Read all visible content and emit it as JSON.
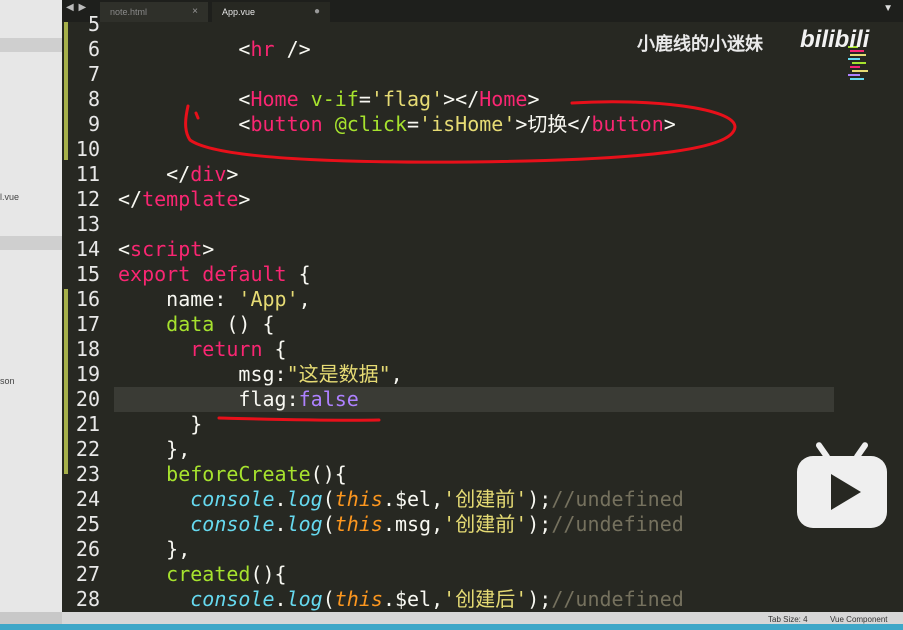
{
  "editor": {
    "tabs": [
      {
        "label": "note.html",
        "close": "×",
        "active": false
      },
      {
        "label": "App.vue",
        "close": "●",
        "active": true
      }
    ],
    "nav_arrows": "◀ ▶",
    "corner_button": "▼"
  },
  "sidebar": {
    "items": [
      {
        "label": "l.vue"
      },
      {
        "label": "son"
      }
    ]
  },
  "code": {
    "line_numbers": [
      "5",
      "6",
      "7",
      "8",
      "9",
      "10",
      "11",
      "12",
      "13",
      "14",
      "15",
      "16",
      "17",
      "18",
      "19",
      "20",
      "21",
      "22",
      "23",
      "24",
      "25",
      "26",
      "27",
      "28"
    ],
    "highlighted_line": "20",
    "lines": [
      [
        {
          "t": "p",
          "v": ""
        }
      ],
      [
        {
          "t": "p",
          "v": "          <"
        },
        {
          "t": "tag",
          "v": "hr"
        },
        {
          "t": "p",
          "v": " />"
        }
      ],
      [
        {
          "t": "p",
          "v": ""
        }
      ],
      [
        {
          "t": "p",
          "v": "          <"
        },
        {
          "t": "tag",
          "v": "Home"
        },
        {
          "t": "p",
          "v": " "
        },
        {
          "t": "attr",
          "v": "v-if"
        },
        {
          "t": "p",
          "v": "="
        },
        {
          "t": "str",
          "v": "'flag'"
        },
        {
          "t": "p",
          "v": "></"
        },
        {
          "t": "tag",
          "v": "Home"
        },
        {
          "t": "p",
          "v": ">"
        }
      ],
      [
        {
          "t": "p",
          "v": "          <"
        },
        {
          "t": "tag",
          "v": "button"
        },
        {
          "t": "p",
          "v": " "
        },
        {
          "t": "attr",
          "v": "@click"
        },
        {
          "t": "p",
          "v": "="
        },
        {
          "t": "str",
          "v": "'isHome'"
        },
        {
          "t": "p",
          "v": ">切换</"
        },
        {
          "t": "tag",
          "v": "button"
        },
        {
          "t": "p",
          "v": ">"
        }
      ],
      [
        {
          "t": "p",
          "v": ""
        }
      ],
      [
        {
          "t": "p",
          "v": "    </"
        },
        {
          "t": "tag",
          "v": "div"
        },
        {
          "t": "p",
          "v": ">"
        }
      ],
      [
        {
          "t": "p",
          "v": "</"
        },
        {
          "t": "tag",
          "v": "template"
        },
        {
          "t": "p",
          "v": ">"
        }
      ],
      [
        {
          "t": "p",
          "v": ""
        }
      ],
      [
        {
          "t": "p",
          "v": "<"
        },
        {
          "t": "tag",
          "v": "script"
        },
        {
          "t": "p",
          "v": ">"
        }
      ],
      [
        {
          "t": "kw",
          "v": "export"
        },
        {
          "t": "p",
          "v": " "
        },
        {
          "t": "kw",
          "v": "default"
        },
        {
          "t": "p",
          "v": " {"
        }
      ],
      [
        {
          "t": "p",
          "v": "    name: "
        },
        {
          "t": "str",
          "v": "'App'"
        },
        {
          "t": "p",
          "v": ","
        }
      ],
      [
        {
          "t": "p",
          "v": "    "
        },
        {
          "t": "fn",
          "v": "data"
        },
        {
          "t": "p",
          "v": " () {"
        }
      ],
      [
        {
          "t": "p",
          "v": "      "
        },
        {
          "t": "kw",
          "v": "return"
        },
        {
          "t": "p",
          "v": " {"
        }
      ],
      [
        {
          "t": "p",
          "v": "          msg:"
        },
        {
          "t": "str",
          "v": "\"这是数据\""
        },
        {
          "t": "p",
          "v": ","
        }
      ],
      [
        {
          "t": "p",
          "v": "          flag:"
        },
        {
          "t": "bool",
          "v": "false"
        }
      ],
      [
        {
          "t": "p",
          "v": "      }"
        }
      ],
      [
        {
          "t": "p",
          "v": "    },"
        }
      ],
      [
        {
          "t": "p",
          "v": "    "
        },
        {
          "t": "fn",
          "v": "beforeCreate"
        },
        {
          "t": "p",
          "v": "(){"
        }
      ],
      [
        {
          "t": "p",
          "v": "      "
        },
        {
          "t": "blue",
          "v": "console"
        },
        {
          "t": "p",
          "v": "."
        },
        {
          "t": "blue",
          "v": "log"
        },
        {
          "t": "p",
          "v": "("
        },
        {
          "t": "this",
          "v": "this"
        },
        {
          "t": "p",
          "v": ".$el,"
        },
        {
          "t": "str",
          "v": "'创建前'"
        },
        {
          "t": "p",
          "v": ");"
        },
        {
          "t": "cm",
          "v": "//undefined"
        }
      ],
      [
        {
          "t": "p",
          "v": "      "
        },
        {
          "t": "blue",
          "v": "console"
        },
        {
          "t": "p",
          "v": "."
        },
        {
          "t": "blue",
          "v": "log"
        },
        {
          "t": "p",
          "v": "("
        },
        {
          "t": "this",
          "v": "this"
        },
        {
          "t": "p",
          "v": ".msg,"
        },
        {
          "t": "str",
          "v": "'创建前'"
        },
        {
          "t": "p",
          "v": ");"
        },
        {
          "t": "cm",
          "v": "//undefined"
        }
      ],
      [
        {
          "t": "p",
          "v": "    },"
        }
      ],
      [
        {
          "t": "p",
          "v": "    "
        },
        {
          "t": "fn",
          "v": "created"
        },
        {
          "t": "p",
          "v": "(){"
        }
      ],
      [
        {
          "t": "p",
          "v": "      "
        },
        {
          "t": "blue",
          "v": "console"
        },
        {
          "t": "p",
          "v": "."
        },
        {
          "t": "blue",
          "v": "log"
        },
        {
          "t": "p",
          "v": "("
        },
        {
          "t": "this",
          "v": "this"
        },
        {
          "t": "p",
          "v": ".$el,"
        },
        {
          "t": "str",
          "v": "'创建后'"
        },
        {
          "t": "p",
          "v": ");"
        },
        {
          "t": "cm",
          "v": "//undefined"
        }
      ]
    ]
  },
  "watermark": {
    "uploader": "小鹿线的小迷妹",
    "logo": "bilibili"
  },
  "statusbar": {
    "tab_size": "Tab Size: 4",
    "syntax": "Vue Component"
  },
  "colors": {
    "background": "#272822",
    "annotation": "#e8101a",
    "tag": "#f92672",
    "attribute": "#a6e22e",
    "string": "#e6db74",
    "boolean": "#ae81ff",
    "comment": "#75715e"
  }
}
